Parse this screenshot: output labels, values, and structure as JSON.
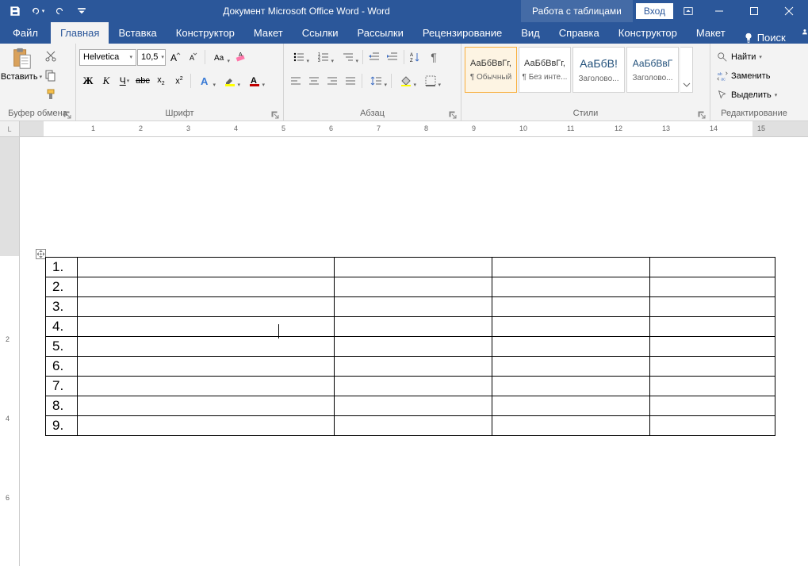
{
  "titlebar": {
    "doc_title": "Документ Microsoft Office Word  -  Word",
    "context_label": "Работа с таблицами",
    "login": "Вход"
  },
  "tabs": {
    "file": "Файл",
    "home": "Главная",
    "insert": "Вставка",
    "design": "Конструктор",
    "layout": "Макет",
    "references": "Ссылки",
    "mailings": "Рассылки",
    "review": "Рецензирование",
    "view": "Вид",
    "help": "Справка",
    "ctx_design": "Конструктор",
    "ctx_layout": "Макет",
    "search": "Поиск",
    "share": "Общий доступ"
  },
  "ribbon": {
    "clipboard": {
      "label": "Буфер обмена",
      "paste": "Вставить"
    },
    "font": {
      "label": "Шрифт",
      "name": "Helvetica",
      "size": "10,5"
    },
    "paragraph": {
      "label": "Абзац"
    },
    "styles": {
      "label": "Стили",
      "items": [
        {
          "preview": "АаБбВвГг,",
          "name": "¶ Обычный"
        },
        {
          "preview": "АаБбВвГг,",
          "name": "¶ Без инте..."
        },
        {
          "preview": "АаБбВ!",
          "name": "Заголово..."
        },
        {
          "preview": "АаБбВвГ",
          "name": "Заголово..."
        }
      ]
    },
    "editing": {
      "label": "Редактирование",
      "find": "Найти",
      "replace": "Заменить",
      "select": "Выделить"
    }
  },
  "table": {
    "rows": [
      "1.",
      "2.",
      "3.",
      "4.",
      "5.",
      "6.",
      "7.",
      "8.",
      "9."
    ]
  }
}
